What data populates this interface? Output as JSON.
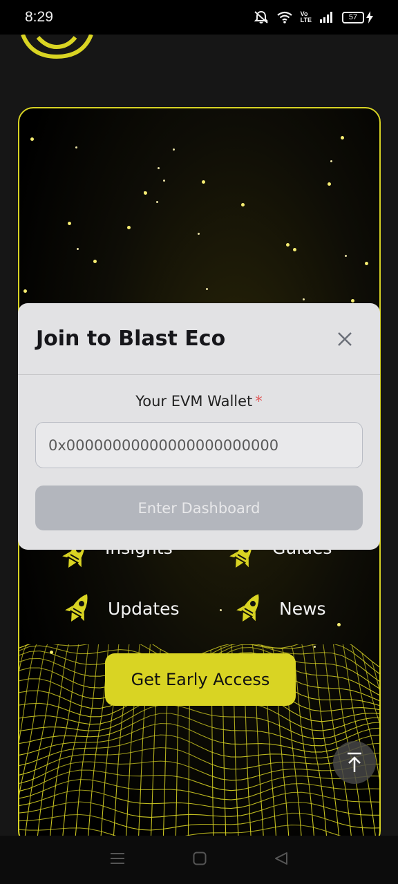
{
  "status_bar": {
    "time": "8:29",
    "network_label_top": "Vo",
    "network_label_bottom": "LTE",
    "battery": "57"
  },
  "features": [
    {
      "label": "Insights"
    },
    {
      "label": "Guides"
    },
    {
      "label": "Updates"
    },
    {
      "label": "News"
    }
  ],
  "cta": {
    "label": "Get Early Access"
  },
  "modal": {
    "title": "Join to Blast Eco",
    "field_label": "Your EVM Wallet",
    "required_mark": "*",
    "wallet_placeholder": "0x00000000000000000000000",
    "submit_label": "Enter Dashboard"
  },
  "colors": {
    "accent": "#d9d423",
    "modal_bg": "#e2e2e4",
    "button_disabled": "#b3b6bd"
  },
  "icons": [
    "bell-muted-icon",
    "wifi-icon",
    "signal-icon",
    "battery-icon",
    "charging-icon",
    "rocket-icon",
    "close-icon",
    "arrow-up-icon",
    "menu-icon",
    "home-icon",
    "back-icon"
  ]
}
